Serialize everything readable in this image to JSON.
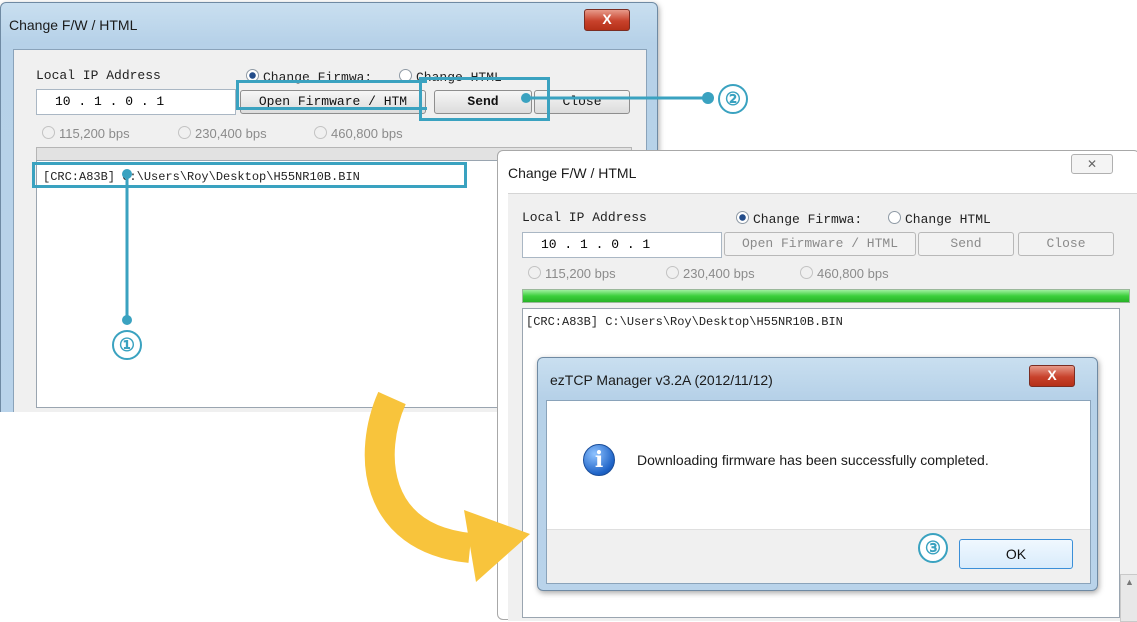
{
  "win1": {
    "title": "Change F/W / HTML",
    "close_glyph": "X",
    "ip_label": "Local IP Address",
    "ip_value": "10 . 1 . 0 . 1",
    "radio_firmware": "Change Firmwa:",
    "radio_html": "Change HTML",
    "open_btn": "Open Firmware / HTM",
    "send_btn": "Send",
    "close_btn": "Close",
    "baud1": "115,200 bps",
    "baud2": "230,400 bps",
    "baud3": "460,800 bps",
    "log_line": "[CRC:A83B] C:\\Users\\Roy\\Desktop\\H55NR10B.BIN"
  },
  "win2": {
    "title": "Change F/W / HTML",
    "close_glyph": "✕",
    "ip_label": "Local IP Address",
    "ip_value": "10 . 1 . 0 . 1",
    "radio_firmware": "Change Firmwa:",
    "radio_html": "Change HTML",
    "open_btn": "Open Firmware / HTML",
    "send_btn": "Send",
    "close_btn": "Close",
    "baud1": "115,200 bps",
    "baud2": "230,400 bps",
    "baud3": "460,800 bps",
    "progress": 1.0,
    "log_line": "[CRC:A83B] C:\\Users\\Roy\\Desktop\\H55NR10B.BIN"
  },
  "dialog": {
    "title": "ezTCP Manager v3.2A (2012/11/12)",
    "close_glyph": "X",
    "icon": "info-icon",
    "message": "Downloading firmware has been successfully completed.",
    "ok_btn": "OK"
  },
  "callouts": {
    "one": "①",
    "two": "②",
    "three": "③"
  },
  "colors": {
    "callout": "#3aa2c0",
    "arrow": "#f8c43c",
    "progress": "#3ccf3c"
  }
}
